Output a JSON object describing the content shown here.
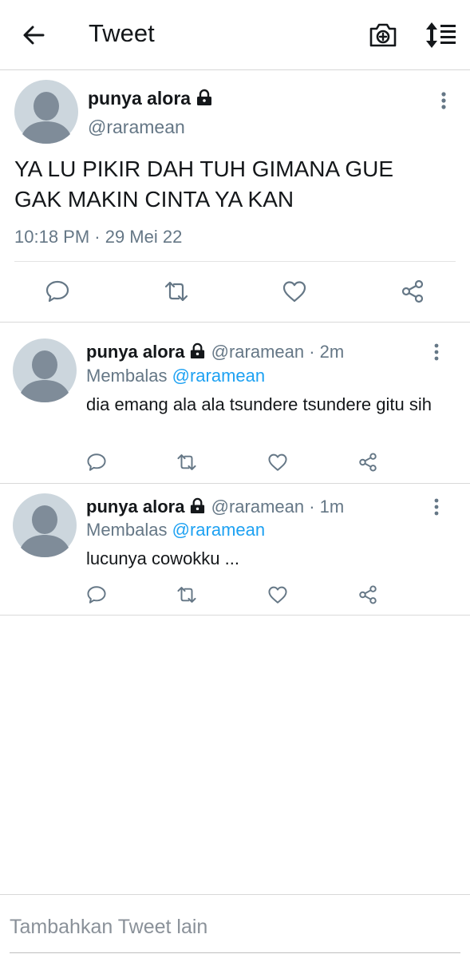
{
  "header": {
    "title": "Tweet",
    "icons": [
      "back-arrow-icon",
      "camera-plus-icon",
      "sort-icon"
    ]
  },
  "tweet": {
    "name": "punya alora",
    "handle": "@raramean",
    "text": "YA LU PIKIR DAH TUH GIMANA GUE GAK MAKIN CINTA YA KAN",
    "timestamp": "10:18 PM · 29 Mei 22",
    "actions": [
      "reply-icon",
      "retweet-icon",
      "like-icon",
      "share-icon"
    ]
  },
  "replies": [
    {
      "name": "punya alora",
      "handle": "@raramean",
      "time": "· 2m",
      "replying_label": "Membalas",
      "replying_to": "@raramean",
      "text": "dia emang ala ala tsundere tsundere gitu sih"
    },
    {
      "name": "punya alora",
      "handle": "@raramean",
      "time": "· 1m",
      "replying_label": "Membalas",
      "replying_to": "@raramean",
      "text": "lucunya cowokku ..."
    }
  ],
  "composer": {
    "placeholder": "Tambahkan Tweet lain"
  },
  "colors": {
    "text": "#14171a",
    "secondary": "#657786",
    "link": "#1da1f2",
    "avatar_bg": "#ccd6dd",
    "avatar_fg": "#7f8c99"
  }
}
